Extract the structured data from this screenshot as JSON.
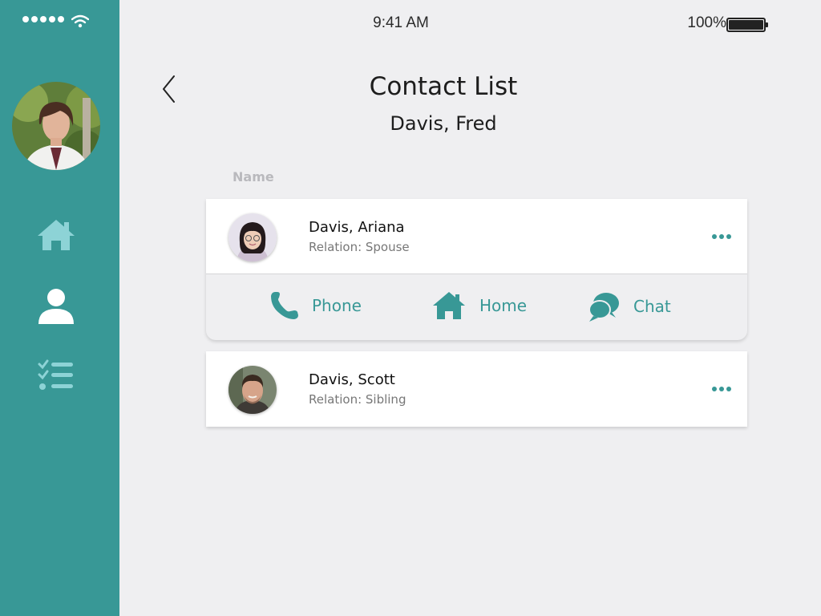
{
  "status_bar": {
    "time": "9:41 AM",
    "battery": "100%"
  },
  "sidebar": {
    "nav": [
      {
        "icon": "home-icon"
      },
      {
        "icon": "person-icon"
      },
      {
        "icon": "checklist-icon"
      }
    ]
  },
  "header": {
    "title": "Contact List",
    "subtitle": "Davis, Fred"
  },
  "list": {
    "column_label": "Name",
    "contacts": [
      {
        "name": "Davis, Ariana",
        "relation": "Relation: Spouse"
      },
      {
        "name": "Davis, Scott",
        "relation": "Relation: Sibling"
      }
    ],
    "actions": [
      {
        "label": "Phone",
        "icon": "phone-icon"
      },
      {
        "label": "Home",
        "icon": "home-icon"
      },
      {
        "label": "Chat",
        "icon": "chat-icon"
      }
    ]
  },
  "colors": {
    "accent": "#389896",
    "nav_icon": "#8dd3d6",
    "background": "#efeff1"
  }
}
